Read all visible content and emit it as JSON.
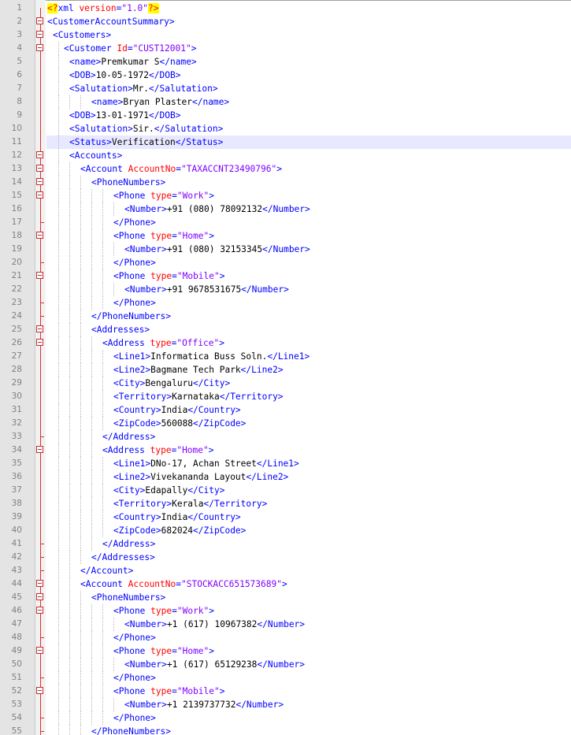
{
  "editor": {
    "current_line": 11,
    "lines": [
      {
        "n": "1",
        "indent": 0,
        "fold": "none",
        "tokens": [
          {
            "t": "decl",
            "v": "<?"
          },
          {
            "t": "tag",
            "v": "xml "
          },
          {
            "t": "attr",
            "v": "version"
          },
          {
            "t": "tag",
            "v": "="
          },
          {
            "t": "val",
            "v": "\"1.0\""
          },
          {
            "t": "decl",
            "v": "?>"
          }
        ]
      },
      {
        "n": "2",
        "indent": 0,
        "fold": "box",
        "tokens": [
          {
            "t": "tag",
            "v": "<CustomerAccountSummary>"
          }
        ]
      },
      {
        "n": "3",
        "indent": 1,
        "fold": "box",
        "tokens": [
          {
            "t": "tag",
            "v": "<Customers>"
          }
        ]
      },
      {
        "n": "4",
        "indent": 3,
        "fold": "box",
        "tokens": [
          {
            "t": "tag",
            "v": "<Customer "
          },
          {
            "t": "attr",
            "v": "Id"
          },
          {
            "t": "tag",
            "v": "="
          },
          {
            "t": "val",
            "v": "\"CUST12001\""
          },
          {
            "t": "tag",
            "v": ">"
          }
        ]
      },
      {
        "n": "5",
        "indent": 4,
        "fold": "line",
        "tokens": [
          {
            "t": "tag",
            "v": "<name>"
          },
          {
            "t": "text",
            "v": "Premkumar S"
          },
          {
            "t": "tag",
            "v": "</name>"
          }
        ]
      },
      {
        "n": "6",
        "indent": 4,
        "fold": "line",
        "tokens": [
          {
            "t": "tag",
            "v": "<DOB>"
          },
          {
            "t": "text",
            "v": "10-05-1972"
          },
          {
            "t": "tag",
            "v": "</DOB>"
          }
        ]
      },
      {
        "n": "7",
        "indent": 4,
        "fold": "line",
        "tokens": [
          {
            "t": "tag",
            "v": "<Salutation>"
          },
          {
            "t": "text",
            "v": "Mr."
          },
          {
            "t": "tag",
            "v": "</Salutation>"
          }
        ]
      },
      {
        "n": "8",
        "indent": 8,
        "fold": "line",
        "tokens": [
          {
            "t": "tag",
            "v": "<name>"
          },
          {
            "t": "text",
            "v": "Bryan Plaster"
          },
          {
            "t": "tag",
            "v": "</name>"
          }
        ]
      },
      {
        "n": "9",
        "indent": 4,
        "fold": "line",
        "tokens": [
          {
            "t": "tag",
            "v": "<DOB>"
          },
          {
            "t": "text",
            "v": "13-01-1971"
          },
          {
            "t": "tag",
            "v": "</DOB>"
          }
        ]
      },
      {
        "n": "10",
        "indent": 4,
        "fold": "line",
        "tokens": [
          {
            "t": "tag",
            "v": "<Salutation>"
          },
          {
            "t": "text",
            "v": "Sir."
          },
          {
            "t": "tag",
            "v": "</Salutation>"
          }
        ]
      },
      {
        "n": "11",
        "indent": 4,
        "fold": "line",
        "tokens": [
          {
            "t": "tag",
            "v": "<Status>"
          },
          {
            "t": "text",
            "v": "Verification"
          },
          {
            "t": "tag",
            "v": "</Status>"
          }
        ]
      },
      {
        "n": "12",
        "indent": 4,
        "fold": "box",
        "tokens": [
          {
            "t": "tag",
            "v": "<Accounts>"
          }
        ]
      },
      {
        "n": "13",
        "indent": 6,
        "fold": "box",
        "tokens": [
          {
            "t": "tag",
            "v": "<Account "
          },
          {
            "t": "attr",
            "v": "AccountNo"
          },
          {
            "t": "tag",
            "v": "="
          },
          {
            "t": "val",
            "v": "\"TAXACCNT23490796\""
          },
          {
            "t": "tag",
            "v": ">"
          }
        ]
      },
      {
        "n": "14",
        "indent": 8,
        "fold": "box",
        "tokens": [
          {
            "t": "tag",
            "v": "<PhoneNumbers>"
          }
        ]
      },
      {
        "n": "15",
        "indent": 12,
        "fold": "box",
        "tokens": [
          {
            "t": "tag",
            "v": "<Phone "
          },
          {
            "t": "attr",
            "v": "type"
          },
          {
            "t": "tag",
            "v": "="
          },
          {
            "t": "val",
            "v": "\"Work\""
          },
          {
            "t": "tag",
            "v": ">"
          }
        ]
      },
      {
        "n": "16",
        "indent": 14,
        "fold": "line",
        "tokens": [
          {
            "t": "tag",
            "v": "<Number>"
          },
          {
            "t": "text",
            "v": "+91 (080) 78092132"
          },
          {
            "t": "tag",
            "v": "</Number>"
          }
        ]
      },
      {
        "n": "17",
        "indent": 12,
        "fold": "tick",
        "tokens": [
          {
            "t": "tag",
            "v": "</Phone>"
          }
        ]
      },
      {
        "n": "18",
        "indent": 12,
        "fold": "box",
        "tokens": [
          {
            "t": "tag",
            "v": "<Phone "
          },
          {
            "t": "attr",
            "v": "type"
          },
          {
            "t": "tag",
            "v": "="
          },
          {
            "t": "val",
            "v": "\"Home\""
          },
          {
            "t": "tag",
            "v": ">"
          }
        ]
      },
      {
        "n": "19",
        "indent": 14,
        "fold": "line",
        "tokens": [
          {
            "t": "tag",
            "v": "<Number>"
          },
          {
            "t": "text",
            "v": "+91 (080) 32153345"
          },
          {
            "t": "tag",
            "v": "</Number>"
          }
        ]
      },
      {
        "n": "20",
        "indent": 12,
        "fold": "tick",
        "tokens": [
          {
            "t": "tag",
            "v": "</Phone>"
          }
        ]
      },
      {
        "n": "21",
        "indent": 12,
        "fold": "box",
        "tokens": [
          {
            "t": "tag",
            "v": "<Phone "
          },
          {
            "t": "attr",
            "v": "type"
          },
          {
            "t": "tag",
            "v": "="
          },
          {
            "t": "val",
            "v": "\"Mobile\""
          },
          {
            "t": "tag",
            "v": ">"
          }
        ]
      },
      {
        "n": "22",
        "indent": 14,
        "fold": "line",
        "tokens": [
          {
            "t": "tag",
            "v": "<Number>"
          },
          {
            "t": "text",
            "v": "+91 9678531675"
          },
          {
            "t": "tag",
            "v": "</Number>"
          }
        ]
      },
      {
        "n": "23",
        "indent": 12,
        "fold": "tick",
        "tokens": [
          {
            "t": "tag",
            "v": "</Phone>"
          }
        ]
      },
      {
        "n": "24",
        "indent": 8,
        "fold": "tick",
        "tokens": [
          {
            "t": "tag",
            "v": "</PhoneNumbers>"
          }
        ]
      },
      {
        "n": "25",
        "indent": 8,
        "fold": "box",
        "tokens": [
          {
            "t": "tag",
            "v": "<Addresses>"
          }
        ]
      },
      {
        "n": "26",
        "indent": 10,
        "fold": "box",
        "tokens": [
          {
            "t": "tag",
            "v": "<Address "
          },
          {
            "t": "attr",
            "v": "type"
          },
          {
            "t": "tag",
            "v": "="
          },
          {
            "t": "val",
            "v": "\"Office\""
          },
          {
            "t": "tag",
            "v": ">"
          }
        ]
      },
      {
        "n": "27",
        "indent": 12,
        "fold": "line",
        "tokens": [
          {
            "t": "tag",
            "v": "<Line1>"
          },
          {
            "t": "text",
            "v": "Informatica Buss Soln."
          },
          {
            "t": "tag",
            "v": "</Line1>"
          }
        ]
      },
      {
        "n": "28",
        "indent": 12,
        "fold": "line",
        "tokens": [
          {
            "t": "tag",
            "v": "<Line2>"
          },
          {
            "t": "text",
            "v": "Bagmane Tech Park"
          },
          {
            "t": "tag",
            "v": "</Line2>"
          }
        ]
      },
      {
        "n": "29",
        "indent": 12,
        "fold": "line",
        "tokens": [
          {
            "t": "tag",
            "v": "<City>"
          },
          {
            "t": "text",
            "v": "Bengaluru"
          },
          {
            "t": "tag",
            "v": "</City>"
          }
        ]
      },
      {
        "n": "30",
        "indent": 12,
        "fold": "line",
        "tokens": [
          {
            "t": "tag",
            "v": "<Territory>"
          },
          {
            "t": "text",
            "v": "Karnataka"
          },
          {
            "t": "tag",
            "v": "</Territory>"
          }
        ]
      },
      {
        "n": "31",
        "indent": 12,
        "fold": "line",
        "tokens": [
          {
            "t": "tag",
            "v": "<Country>"
          },
          {
            "t": "text",
            "v": "India"
          },
          {
            "t": "tag",
            "v": "</Country>"
          }
        ]
      },
      {
        "n": "32",
        "indent": 12,
        "fold": "line",
        "tokens": [
          {
            "t": "tag",
            "v": "<ZipCode>"
          },
          {
            "t": "text",
            "v": "560088"
          },
          {
            "t": "tag",
            "v": "</ZipCode>"
          }
        ]
      },
      {
        "n": "33",
        "indent": 10,
        "fold": "tick",
        "tokens": [
          {
            "t": "tag",
            "v": "</Address>"
          }
        ]
      },
      {
        "n": "34",
        "indent": 10,
        "fold": "box",
        "tokens": [
          {
            "t": "tag",
            "v": "<Address "
          },
          {
            "t": "attr",
            "v": "type"
          },
          {
            "t": "tag",
            "v": "="
          },
          {
            "t": "val",
            "v": "\"Home\""
          },
          {
            "t": "tag",
            "v": ">"
          }
        ]
      },
      {
        "n": "35",
        "indent": 12,
        "fold": "line",
        "tokens": [
          {
            "t": "tag",
            "v": "<Line1>"
          },
          {
            "t": "text",
            "v": "DNo-17, Achan Street"
          },
          {
            "t": "tag",
            "v": "</Line1>"
          }
        ]
      },
      {
        "n": "36",
        "indent": 12,
        "fold": "line",
        "tokens": [
          {
            "t": "tag",
            "v": "<Line2>"
          },
          {
            "t": "text",
            "v": "Vivekananda Layout"
          },
          {
            "t": "tag",
            "v": "</Line2>"
          }
        ]
      },
      {
        "n": "37",
        "indent": 12,
        "fold": "line",
        "tokens": [
          {
            "t": "tag",
            "v": "<City>"
          },
          {
            "t": "text",
            "v": "Edapally"
          },
          {
            "t": "tag",
            "v": "</City>"
          }
        ]
      },
      {
        "n": "38",
        "indent": 12,
        "fold": "line",
        "tokens": [
          {
            "t": "tag",
            "v": "<Territory>"
          },
          {
            "t": "text",
            "v": "Kerala"
          },
          {
            "t": "tag",
            "v": "</Territory>"
          }
        ]
      },
      {
        "n": "39",
        "indent": 12,
        "fold": "line",
        "tokens": [
          {
            "t": "tag",
            "v": "<Country>"
          },
          {
            "t": "text",
            "v": "India"
          },
          {
            "t": "tag",
            "v": "</Country>"
          }
        ]
      },
      {
        "n": "40",
        "indent": 12,
        "fold": "line",
        "tokens": [
          {
            "t": "tag",
            "v": "<ZipCode>"
          },
          {
            "t": "text",
            "v": "682024"
          },
          {
            "t": "tag",
            "v": "</ZipCode>"
          }
        ]
      },
      {
        "n": "41",
        "indent": 10,
        "fold": "tick",
        "tokens": [
          {
            "t": "tag",
            "v": "</Address>"
          }
        ]
      },
      {
        "n": "42",
        "indent": 8,
        "fold": "tick",
        "tokens": [
          {
            "t": "tag",
            "v": "</Addresses>"
          }
        ]
      },
      {
        "n": "43",
        "indent": 6,
        "fold": "tick",
        "tokens": [
          {
            "t": "tag",
            "v": "</Account>"
          }
        ]
      },
      {
        "n": "44",
        "indent": 6,
        "fold": "box",
        "tokens": [
          {
            "t": "tag",
            "v": "<Account "
          },
          {
            "t": "attr",
            "v": "AccountNo"
          },
          {
            "t": "tag",
            "v": "="
          },
          {
            "t": "val",
            "v": "\"STOCKACC651573689\""
          },
          {
            "t": "tag",
            "v": ">"
          }
        ]
      },
      {
        "n": "45",
        "indent": 8,
        "fold": "box",
        "tokens": [
          {
            "t": "tag",
            "v": "<PhoneNumbers>"
          }
        ]
      },
      {
        "n": "46",
        "indent": 12,
        "fold": "box",
        "tokens": [
          {
            "t": "tag",
            "v": "<Phone "
          },
          {
            "t": "attr",
            "v": "type"
          },
          {
            "t": "tag",
            "v": "="
          },
          {
            "t": "val",
            "v": "\"Work\""
          },
          {
            "t": "tag",
            "v": ">"
          }
        ]
      },
      {
        "n": "47",
        "indent": 14,
        "fold": "line",
        "tokens": [
          {
            "t": "tag",
            "v": "<Number>"
          },
          {
            "t": "text",
            "v": "+1 (617) 10967382"
          },
          {
            "t": "tag",
            "v": "</Number>"
          }
        ]
      },
      {
        "n": "48",
        "indent": 12,
        "fold": "tick",
        "tokens": [
          {
            "t": "tag",
            "v": "</Phone>"
          }
        ]
      },
      {
        "n": "49",
        "indent": 12,
        "fold": "box",
        "tokens": [
          {
            "t": "tag",
            "v": "<Phone "
          },
          {
            "t": "attr",
            "v": "type"
          },
          {
            "t": "tag",
            "v": "="
          },
          {
            "t": "val",
            "v": "\"Home\""
          },
          {
            "t": "tag",
            "v": ">"
          }
        ]
      },
      {
        "n": "50",
        "indent": 14,
        "fold": "line",
        "tokens": [
          {
            "t": "tag",
            "v": "<Number>"
          },
          {
            "t": "text",
            "v": "+1 (617) 65129238"
          },
          {
            "t": "tag",
            "v": "</Number>"
          }
        ]
      },
      {
        "n": "51",
        "indent": 12,
        "fold": "tick",
        "tokens": [
          {
            "t": "tag",
            "v": "</Phone>"
          }
        ]
      },
      {
        "n": "52",
        "indent": 12,
        "fold": "box",
        "tokens": [
          {
            "t": "tag",
            "v": "<Phone "
          },
          {
            "t": "attr",
            "v": "type"
          },
          {
            "t": "tag",
            "v": "="
          },
          {
            "t": "val",
            "v": "\"Mobile\""
          },
          {
            "t": "tag",
            "v": ">"
          }
        ]
      },
      {
        "n": "53",
        "indent": 14,
        "fold": "line",
        "tokens": [
          {
            "t": "tag",
            "v": "<Number>"
          },
          {
            "t": "text",
            "v": "+1 2139737732"
          },
          {
            "t": "tag",
            "v": "</Number>"
          }
        ]
      },
      {
        "n": "54",
        "indent": 12,
        "fold": "tick",
        "tokens": [
          {
            "t": "tag",
            "v": "</Phone>"
          }
        ]
      },
      {
        "n": "55",
        "indent": 8,
        "fold": "tick",
        "tokens": [
          {
            "t": "tag",
            "v": "</PhoneNumbers>"
          }
        ]
      }
    ]
  }
}
